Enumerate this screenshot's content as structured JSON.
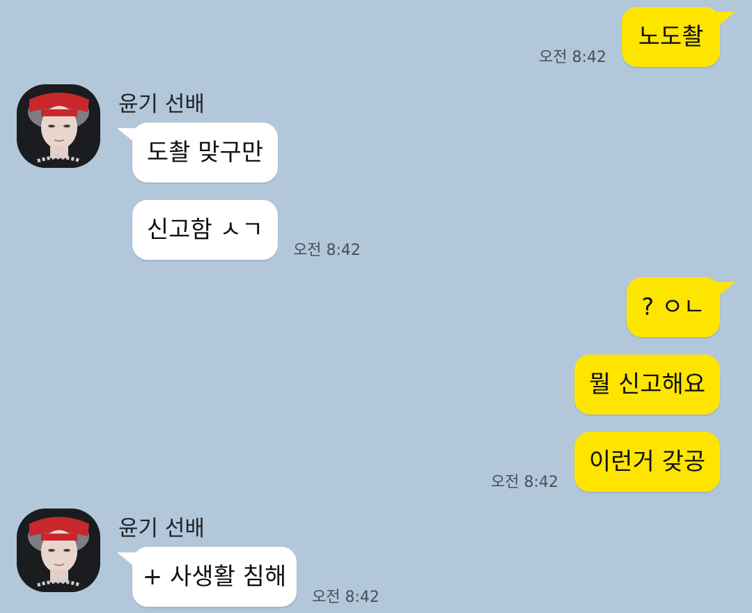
{
  "app": {
    "background_color": "#b2c7da",
    "my_bubble_color": "#fee500",
    "their_bubble_color": "#ffffff"
  },
  "messages": [
    {
      "side": "me",
      "text": "노도촬",
      "time": "오전 8:42"
    },
    {
      "side": "them",
      "sender": "윤기 선배",
      "text": "도촬 맞구만"
    },
    {
      "side": "them",
      "text": "신고함 ㅅㄱ",
      "time": "오전 8:42"
    },
    {
      "side": "me",
      "text": "? ㅇㄴ"
    },
    {
      "side": "me",
      "text": "뭘 신고해요"
    },
    {
      "side": "me",
      "text": "이런거 갖공",
      "time": "오전 8:42"
    },
    {
      "side": "them",
      "sender": "윤기 선배",
      "text": "+ 사생활 침해",
      "time": "오전 8:42"
    }
  ],
  "avatar": {
    "icon": "profile-photo"
  }
}
